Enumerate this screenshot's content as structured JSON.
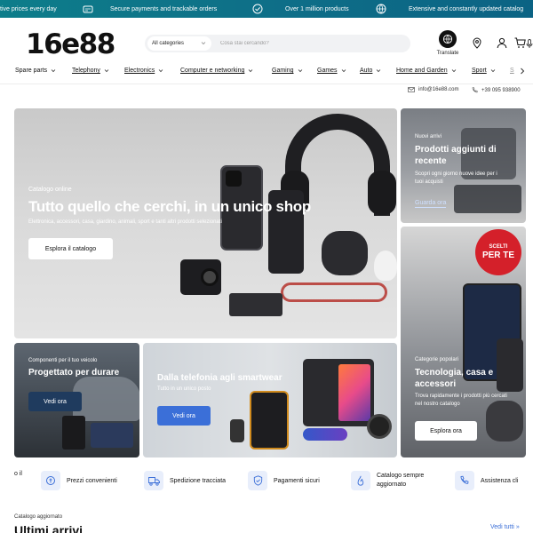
{
  "promo": {
    "items": [
      {
        "text": "tive prices every day",
        "icon": "price-tag-icon"
      },
      {
        "text": "Secure payments and trackable orders",
        "icon": "secure-payment-icon"
      },
      {
        "text": "Over 1 million products",
        "icon": "checkmark-badge-icon"
      },
      {
        "text": "Extensive and constantly updated catalog",
        "icon": "globe-icon"
      }
    ]
  },
  "header": {
    "logo": "16e88",
    "category_select": "All categories",
    "search_placeholder": "Cosa stai cercando?",
    "translate_label": "Translate"
  },
  "nav": {
    "items": [
      "Spare parts",
      "Telephony",
      "Electronics",
      "Computer e networking",
      "Gaming",
      "Games",
      "Auto",
      "Home and Garden",
      "Sport",
      "S"
    ]
  },
  "contact": {
    "email": "info@16e88.com",
    "phone": "+39 095 938900"
  },
  "hero": {
    "main": {
      "kicker": "Catalogo online",
      "title": "Tutto quello che cerchi, in un unico shop",
      "subtitle": "Elettronica, accessori, casa, giardino, animali, sport e tanti altri prodotti selezionati",
      "button": "Esplora il catalogo"
    },
    "new_arrivals": {
      "kicker": "Nuovi arrivi",
      "title": "Prodotti aggiunti di recente",
      "subtitle": "Scopri ogni giorno nuove idee per i tuoi acquisti",
      "link": "Guarda ora"
    },
    "tech": {
      "badge_top": "SCELTI",
      "badge_bottom": "PER TE",
      "kicker": "Categorie popolari",
      "title": "Tecnologia, casa e accessori",
      "subtitle": "Trova rapidamente i prodotti più cercati nel nostro catalogo",
      "button": "Esplora ora"
    },
    "car": {
      "kicker": "Componenti per il tuo veicolo",
      "title": "Progettato per durare",
      "button": "Vedi ora"
    },
    "phone": {
      "title": "Dalla telefonia agli smartwear",
      "subtitle": "Tutto in un unico posto",
      "button": "Vedi ora"
    }
  },
  "features": {
    "partial": "o il",
    "items": [
      {
        "label": "Prezzi convenienti",
        "icon": "price-cycle-icon"
      },
      {
        "label": "Spedizione tracciata",
        "icon": "truck-icon"
      },
      {
        "label": "Pagamenti sicuri",
        "icon": "shield-icon"
      },
      {
        "label": "Catalogo sempre aggiornato",
        "icon": "flame-icon"
      },
      {
        "label": "Assistenza cli",
        "icon": "phone-support-icon"
      }
    ]
  },
  "catalog": {
    "kicker": "Catalogo aggiornato",
    "title": "Ultimi arrivi",
    "view_all": "Vedi tutti"
  },
  "colors": {
    "promo_bar": "#0e6f88",
    "accent_blue": "#3b6fd8",
    "badge_red": "#d4202a",
    "navy_button": "#1f3b5e"
  }
}
